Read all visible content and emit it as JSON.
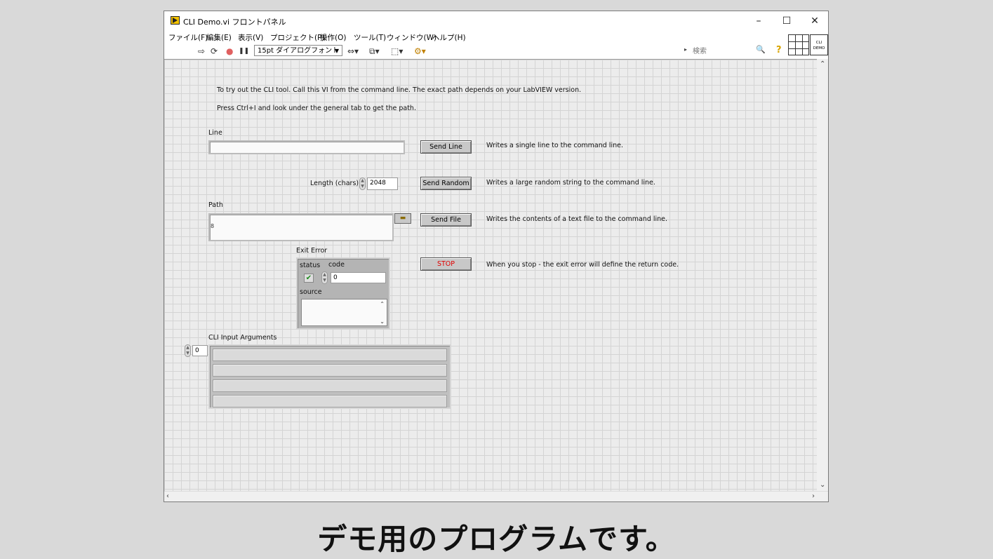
{
  "window": {
    "title": "CLI Demo.vi フロントパネル",
    "controls": {
      "minimize": "–",
      "maximize": "☐",
      "close": "✕"
    }
  },
  "menu": [
    "ファイル(F)",
    "編集(E)",
    "表示(V)",
    "プロジェクト(P)",
    "操作(O)",
    "ツール(T)",
    "ウィンドウ(W)",
    "ヘルプ(H)"
  ],
  "toolbar": {
    "run_icon": "⇨",
    "run_continuous_icon": "⟳",
    "abort_icon": "●",
    "pause_icon": "❚❚",
    "font_select": "15pt ダイアログフォント",
    "align_icon": "⇔▾",
    "distribute_icon": "⧉▾",
    "resize_icon": "⬚▾",
    "reorder_icon": "⚙▾",
    "search_placeholder": "検索",
    "search_icon": "🔍",
    "help_icon": "?",
    "vi_icon_text": "CLI DEMO"
  },
  "panel": {
    "instruction1": "To try out the CLI tool. Call this VI from the command line. The exact path depends on your LabVIEW version.",
    "instruction2": "Press Ctrl+I and look under the general tab to get the path.",
    "line_label": "Line",
    "line_value": "",
    "send_line": "Send Line",
    "send_line_desc": "Writes a single line to the command line.",
    "length_label": "Length (chars)",
    "length_value": "2048",
    "send_random": "Send Random",
    "send_random_desc": "Writes a large random string to the command line.",
    "path_label": "Path",
    "path_value": "",
    "path_prefix": "8",
    "send_file": "Send File",
    "send_file_desc": "Writes the contents of a text file to the command line.",
    "exit_error_label": "Exit Error",
    "status_label": "status",
    "status_check": "✔",
    "code_label": "code",
    "code_value": "0",
    "source_label": "source",
    "stop": "STOP",
    "stop_desc": "When you stop - the exit error will define the return code.",
    "cli_args_label": "CLI Input Arguments",
    "cli_args_index": "0"
  },
  "caption": "デモ用のプログラムです。"
}
